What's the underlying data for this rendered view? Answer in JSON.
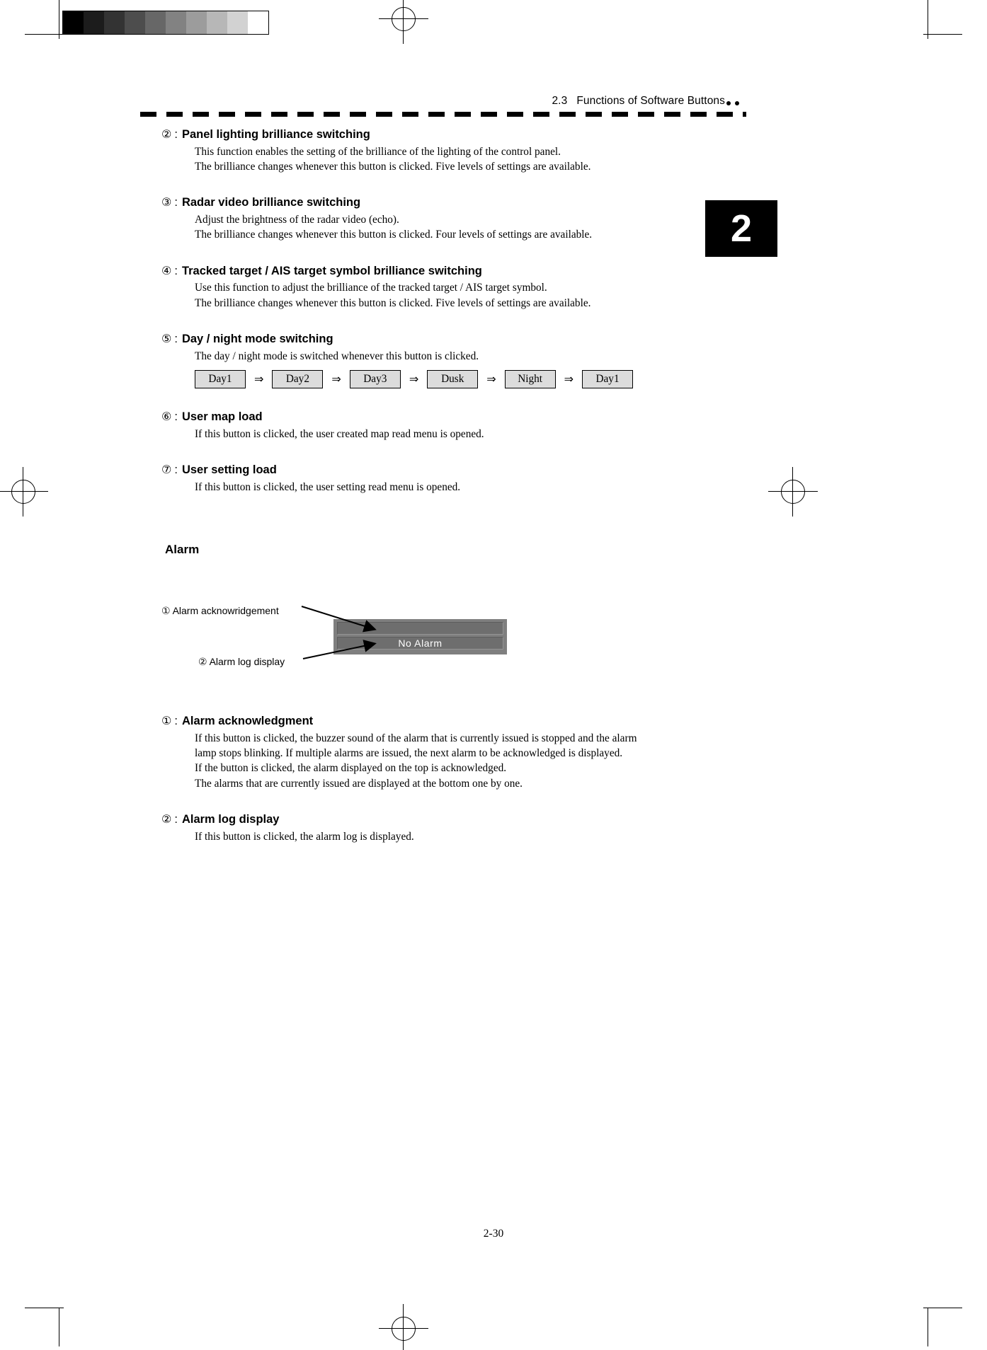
{
  "header": {
    "section_number": "2.3",
    "section_title": "Functions of Software Buttons",
    "chapter_tab": "2"
  },
  "grayscale_strip": {
    "name": "grayscale-calibration-strip",
    "steps": [
      "#000000",
      "#1c1c1c",
      "#333333",
      "#4d4d4d",
      "#676767",
      "#828282",
      "#9c9c9c",
      "#b7b7b7",
      "#d2d2d2",
      "#ffffff"
    ]
  },
  "items": [
    {
      "number": "②",
      "title": "Panel lighting brilliance switching",
      "lines": [
        "This function enables the setting of the brilliance of the lighting of the control panel.",
        "The brilliance changes whenever this button is clicked.    Five levels of settings are available."
      ]
    },
    {
      "number": "③",
      "title": "Radar video brilliance switching",
      "lines": [
        "Adjust the brightness of the radar video (echo).",
        "The brilliance changes whenever this button is clicked.    Four levels of settings are available."
      ]
    },
    {
      "number": "④",
      "title": "Tracked target / AIS target symbol brilliance switching",
      "lines": [
        "Use this function to adjust the brilliance of the tracked target / AIS target symbol.",
        "The brilliance changes whenever this button is clicked.    Five levels of settings are available."
      ]
    },
    {
      "number": "⑤",
      "title": "Day / night mode switching",
      "lines": [
        "The day / night mode is switched whenever this button is clicked."
      ]
    },
    {
      "number": "⑥",
      "title": "User map load",
      "lines": [
        "If this button is clicked, the user created map read menu is opened."
      ]
    },
    {
      "number": "⑦",
      "title": "User setting load",
      "lines": [
        "If this button is clicked, the user setting read menu is opened."
      ]
    }
  ],
  "mode_chain": {
    "arrow": "⇒",
    "buttons": [
      "Day1",
      "Day2",
      "Day3",
      "Dusk",
      "Night",
      "Day1"
    ]
  },
  "alarm_section": {
    "title": "Alarm",
    "figure": {
      "callout_ack": {
        "number": "①",
        "label": "Alarm acknowridgement"
      },
      "callout_log": {
        "number": "②",
        "label": "Alarm log display"
      },
      "widget_text": "No  Alarm",
      "widget_bg": "#7f7f7f",
      "widget_bar": "#6e6e6e"
    },
    "items": [
      {
        "number": "①",
        "title": "Alarm acknowledgment",
        "lines": [
          "If this button is clicked, the buzzer sound of the alarm that is currently issued is stopped and the alarm",
          "lamp stops blinking.    If multiple alarms are issued, the next alarm to be acknowledged is displayed.",
          "If the button is clicked, the alarm displayed on the top is acknowledged.",
          "The alarms that are currently issued are displayed at the bottom one by one."
        ]
      },
      {
        "number": "②",
        "title": "Alarm log display",
        "lines": [
          "If this button is clicked, the alarm log is displayed."
        ]
      }
    ]
  },
  "footer": {
    "page_number": "2-30"
  }
}
